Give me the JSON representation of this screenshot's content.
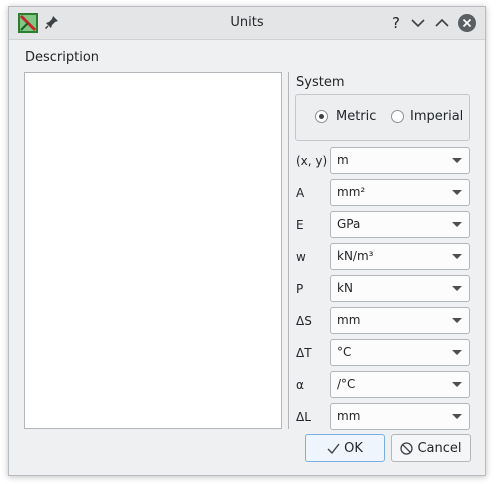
{
  "window": {
    "title": "Units"
  },
  "titlebar": {
    "app_icon": "app-icon",
    "pin_icon": "pin-icon",
    "help_glyph": "?",
    "help_icon": "help-icon",
    "minimize_icon": "chevron-down-icon",
    "maximize_icon": "chevron-up-icon",
    "close_icon": "close-icon"
  },
  "description": {
    "label": "Description",
    "value": ""
  },
  "system": {
    "label": "System",
    "options": [
      {
        "label": "Metric",
        "selected": true
      },
      {
        "label": "Imperial",
        "selected": false
      }
    ]
  },
  "units": [
    {
      "label": "(x, y)",
      "value": "m"
    },
    {
      "label": "A",
      "value": "mm²"
    },
    {
      "label": "E",
      "value": "GPa"
    },
    {
      "label": "w",
      "value": "kN/m³"
    },
    {
      "label": "P",
      "value": "kN"
    },
    {
      "label": "ΔS",
      "value": "mm"
    },
    {
      "label": "ΔT",
      "value": "°C"
    },
    {
      "label": "α",
      "value": "/°C"
    },
    {
      "label": "ΔL",
      "value": "mm"
    }
  ],
  "buttons": {
    "ok_label": "OK",
    "ok_icon": "checkmark-icon",
    "cancel_label": "Cancel",
    "cancel_icon": "cancel-icon"
  },
  "colors": {
    "accent": "#3daee9",
    "window_bg": "#eff0f1"
  }
}
